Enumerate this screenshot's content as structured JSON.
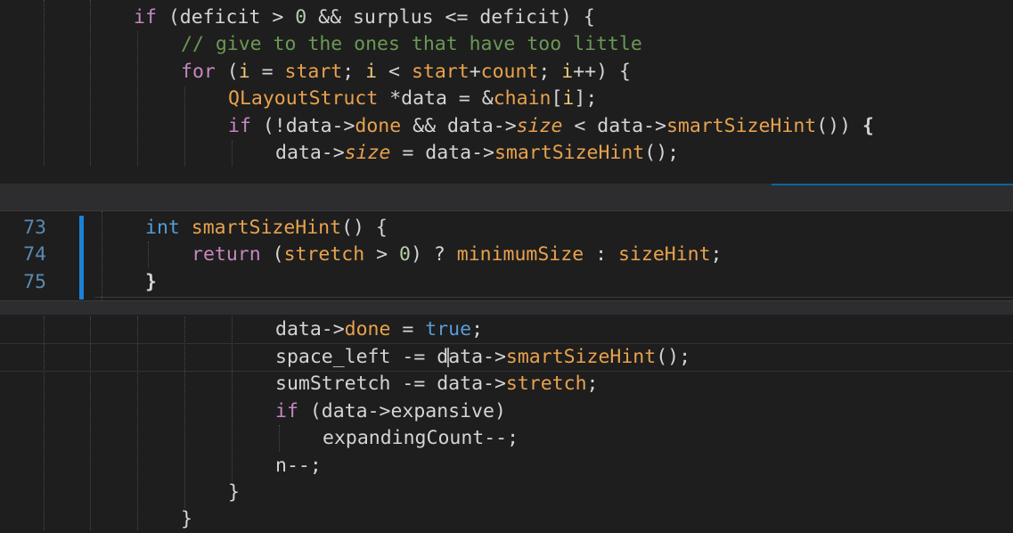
{
  "editor": {
    "top_lines": [
      "if (deficit > 0 && surplus <= deficit) {",
      "// give to the ones that have too little",
      "for (i = start; i < start+count; i++) {",
      "QLayoutStruct *data = &chain[i];",
      "if (!data->done && data->size < data->smartSizeHint()) {",
      "data->size = data->smartSizeHint();"
    ],
    "bottom_lines": [
      "data->done = true;",
      "space_left -= data->smartSizeHint();",
      "sumStretch -= data->stretch;",
      "if (data->expansive)",
      "expandingCount--;",
      "n--;",
      "}",
      "}"
    ]
  },
  "peek": {
    "line_numbers": [
      "73",
      "74",
      "75"
    ],
    "lines": [
      "int smartSizeHint() {",
      "return (stretch > 0) ? minimumSize : sizeHint;",
      "}"
    ]
  },
  "colors": {
    "background": "#1e1e1e",
    "peek_background": "#252526",
    "change_bar": "#1b81d6",
    "keyword": "#c586c0",
    "comment": "#6a9955",
    "function": "#e8a24d"
  }
}
